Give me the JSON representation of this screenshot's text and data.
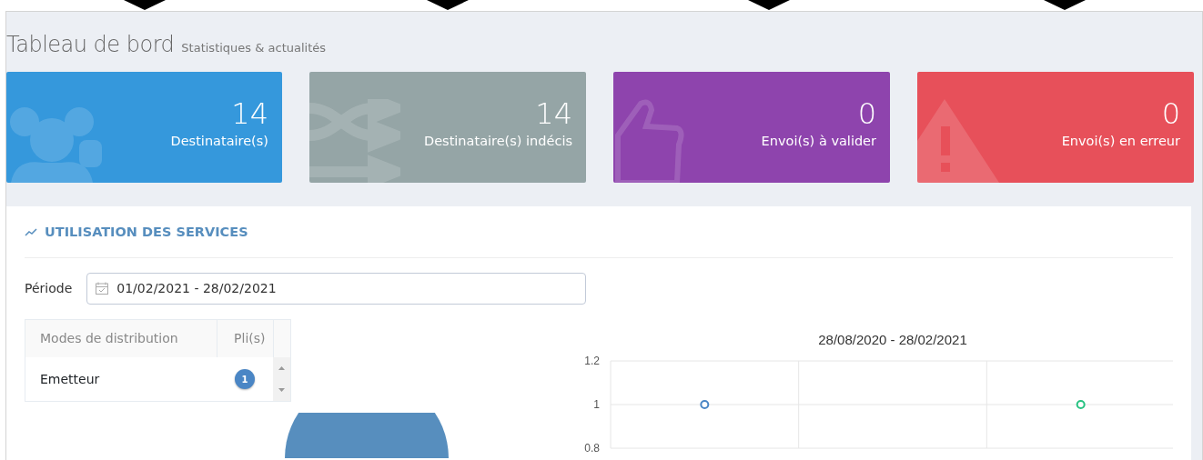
{
  "page": {
    "title": "Tableau de bord",
    "subtitle": "Statistiques & actualités"
  },
  "stat_cards": [
    {
      "value": "14",
      "label": "Destinataire(s)",
      "color": "#3598dc",
      "kind": "users"
    },
    {
      "value": "14",
      "label": "Destinataire(s) indécis",
      "color": "#95a5a6",
      "kind": "shuffle"
    },
    {
      "value": "0",
      "label": "Envoi(s) à valider",
      "color": "#8e44ad",
      "kind": "thumb"
    },
    {
      "value": "0",
      "label": "Envoi(s) en erreur",
      "color": "#e7505a",
      "kind": "warning"
    }
  ],
  "panel": {
    "title": "UTILISATION DES SERVICES",
    "period": {
      "label": "Période",
      "value": "01/02/2021 - 28/02/2021"
    },
    "table": {
      "columns": [
        "Modes de distribution",
        "Pli(s)"
      ],
      "rows": [
        {
          "mode": "Emetteur",
          "count": "1"
        }
      ]
    },
    "chart": {
      "chart_data": {
        "type": "scatter",
        "title": "28/08/2020 - 28/02/2021",
        "ylim": [
          0.8,
          1.2
        ],
        "yticks": [
          {
            "value": 0.8,
            "label": "0.8"
          },
          {
            "value": 1,
            "label": "1"
          },
          {
            "value": 1.2,
            "label": "1.2"
          }
        ],
        "series": [
          {
            "color": "#4a86c5",
            "values": [
              1,
              null,
              null
            ]
          },
          {
            "color": "#26c281",
            "values": [
              null,
              null,
              1
            ]
          }
        ]
      }
    }
  }
}
